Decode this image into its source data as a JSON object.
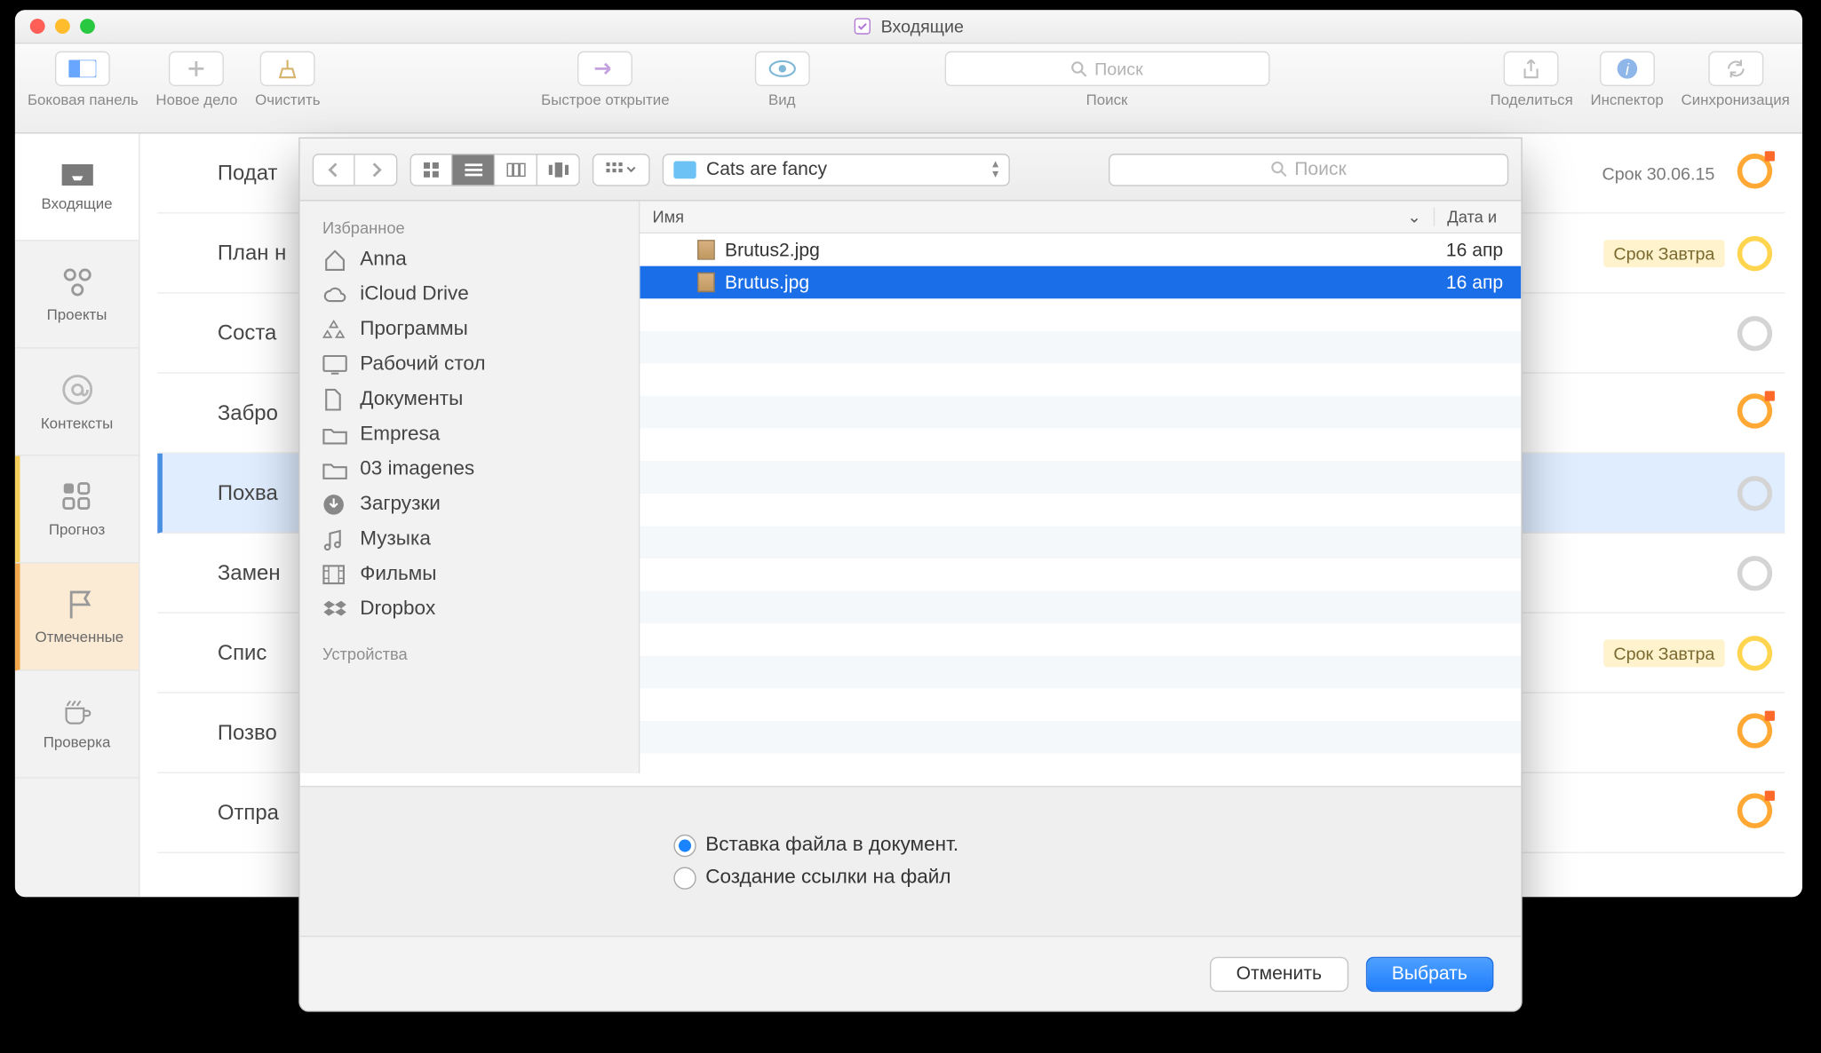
{
  "window": {
    "title": "Входящие"
  },
  "toolbar": {
    "sidebar": "Боковая панель",
    "new": "Новое дело",
    "clean": "Очистить",
    "quick": "Быстрое открытие",
    "view": "Вид",
    "search_label": "Поиск",
    "search_placeholder": "Поиск",
    "share": "Поделиться",
    "inspector": "Инспектор",
    "sync": "Синхронизация"
  },
  "nav": [
    {
      "label": "Входящие"
    },
    {
      "label": "Проекты"
    },
    {
      "label": "Контексты"
    },
    {
      "label": "Прогноз"
    },
    {
      "label": "Отмеченные"
    },
    {
      "label": "Проверка"
    }
  ],
  "tasks": [
    {
      "title": "Подат",
      "badge": "Срок 30.06.15",
      "circle": "orange",
      "flag": true
    },
    {
      "title": "План н",
      "badge": "Срок Завтра",
      "circle": "yellow",
      "flag": false
    },
    {
      "title": "Соста",
      "badge": "",
      "circle": "gray",
      "flag": false
    },
    {
      "title": "Забро",
      "badge": "",
      "circle": "orange",
      "flag": true
    },
    {
      "title": "Похва",
      "badge": "",
      "circle": "gray",
      "flag": false,
      "selected": true
    },
    {
      "title": "Замен",
      "badge": "",
      "circle": "gray",
      "flag": false
    },
    {
      "title": "Спис",
      "badge": "Срок Завтра",
      "circle": "yellow",
      "flag": false
    },
    {
      "title": "Позво",
      "badge": "",
      "circle": "orange",
      "flag": true
    },
    {
      "title": "Отпра",
      "badge": "",
      "circle": "orange",
      "flag": true
    }
  ],
  "finder": {
    "folder": "Cats are fancy",
    "search_placeholder": "Поиск",
    "sidebar_headers": {
      "fav": "Избранное",
      "dev": "Устройства"
    },
    "favorites": [
      "Anna",
      "iCloud Drive",
      "Программы",
      "Рабочий стол",
      "Документы",
      "Empresa",
      "03 imagenes",
      "Загрузки",
      "Музыка",
      "Фильмы",
      "Dropbox"
    ],
    "columns": {
      "name": "Имя",
      "date": "Дата и"
    },
    "files": [
      {
        "name": "Brutus2.jpg",
        "date": "16 апр",
        "selected": false
      },
      {
        "name": "Brutus.jpg",
        "date": "16 апр",
        "selected": true
      }
    ],
    "options": {
      "embed": "Вставка файла в документ.",
      "link": "Создание ссылки на файл"
    },
    "buttons": {
      "cancel": "Отменить",
      "choose": "Выбрать"
    }
  }
}
